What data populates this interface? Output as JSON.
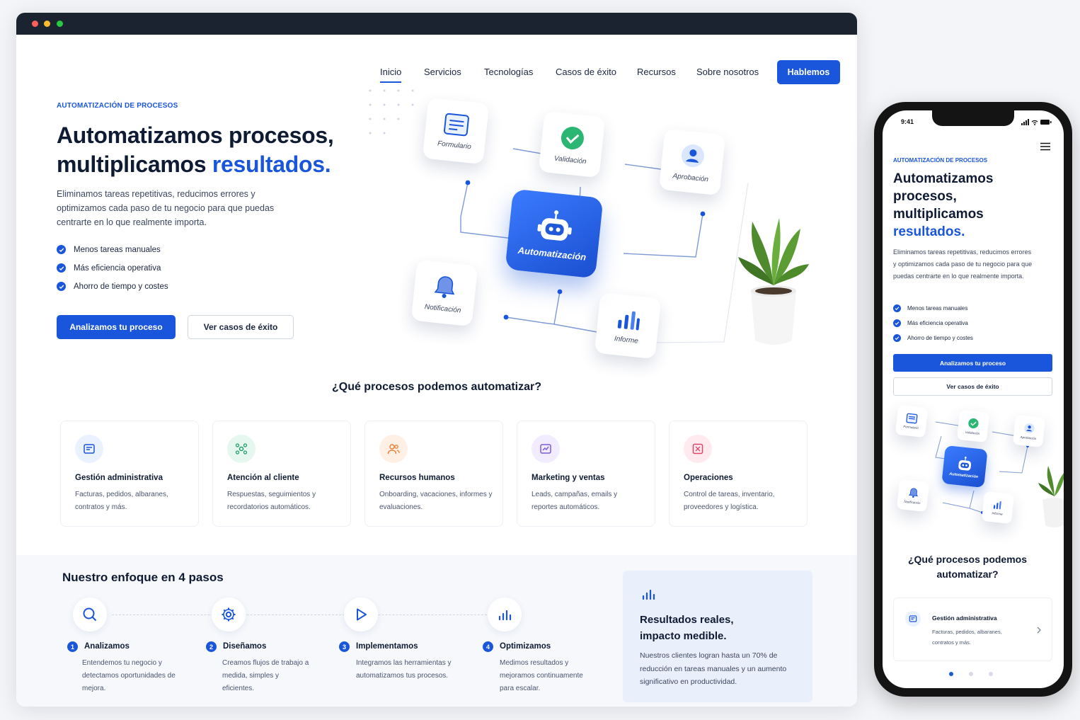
{
  "window": {
    "dots": [
      "#ff5f57",
      "#febc2e",
      "#28c840"
    ]
  },
  "nav": {
    "items": [
      "Inicio",
      "Servicios",
      "Tecnologías",
      "Casos de éxito",
      "Recursos",
      "Sobre nosotros"
    ],
    "cta": "Hablemos"
  },
  "hero": {
    "eyebrow": "AUTOMATIZACIÓN DE PROCESOS",
    "title_line1": "Automatizamos procesos,",
    "title_line2": "multiplicamos ",
    "title_highlight": "resultados.",
    "description": "Eliminamos tareas repetitivas, reducimos errores y optimizamos cada paso de tu negocio para que puedas centrarte en lo que realmente importa.",
    "benefits": [
      "Menos tareas manuales",
      "Más eficiencia operativa",
      "Ahorro de tiempo y costes"
    ],
    "primary_cta": "Analizamos tu proceso",
    "secondary_cta": "Ver casos de éxito"
  },
  "diagram": {
    "center": "Automatización",
    "nodes": [
      "Formulario",
      "Validación",
      "Aprobación",
      "Notificación",
      "Informe"
    ]
  },
  "processes": {
    "title": "¿Qué procesos podemos automatizar?",
    "items": [
      {
        "title": "Gestión administrativa",
        "desc": "Facturas, pedidos, albaranes, contratos y más.",
        "icon": "document-icon",
        "color": "#eaf1ff",
        "fg": "#1a56db"
      },
      {
        "title": "Atención al cliente",
        "desc": "Respuestas, seguimientos y recordatorios automáticos.",
        "icon": "network-icon",
        "color": "#e6f7ef",
        "fg": "#22a06b"
      },
      {
        "title": "Recursos humanos",
        "desc": "Onboarding, vacaciones, informes y evaluaciones.",
        "icon": "users-icon",
        "color": "#fff0e6",
        "fg": "#e8833a"
      },
      {
        "title": "Marketing y ventas",
        "desc": "Leads, campañas, emails y reportes automáticos.",
        "icon": "chart-board-icon",
        "color": "#f1ecff",
        "fg": "#7c5ce0"
      },
      {
        "title": "Operaciones",
        "desc": "Control de tareas, inventario, proveedores y logística.",
        "icon": "box-icon",
        "color": "#ffeaf0",
        "fg": "#e0456c"
      }
    ]
  },
  "approach": {
    "title": "Nuestro enfoque en 4 pasos",
    "steps": [
      {
        "n": "1",
        "title": "Analizamos",
        "desc": "Entendemos tu negocio y detectamos oportunidades de mejora.",
        "icon": "search-icon"
      },
      {
        "n": "2",
        "title": "Diseñamos",
        "desc": "Creamos flujos de trabajo a medida, simples y eficientes.",
        "icon": "gear-icon"
      },
      {
        "n": "3",
        "title": "Implementamos",
        "desc": "Integramos las herramientas y automatizamos tus procesos.",
        "icon": "play-icon"
      },
      {
        "n": "4",
        "title": "Optimizamos",
        "desc": "Medimos resultados y mejoramos continuamente para escalar.",
        "icon": "bar-chart-icon"
      }
    ],
    "results_title_1": "Resultados reales,",
    "results_title_2": "impacto medible.",
    "results_desc": "Nuestros clientes logran hasta un 70% de reducción en tareas manuales y un aumento significativo en productividad."
  },
  "mobile": {
    "time": "9:41",
    "eyebrow": "AUTOMATIZACIÓN DE PROCESOS",
    "title_1": "Automatizamos",
    "title_2": "procesos,",
    "title_3": "multiplicamos",
    "title_4": "resultados.",
    "description": "Eliminamos tareas repetitivas, reducimos errores y optimizamos cada paso de tu negocio para que puedas centrarte en lo que realmente importa.",
    "benefits": [
      "Menos tareas manuales",
      "Más eficiencia operativa",
      "Ahorro de tiempo y costes"
    ],
    "primary_cta": "Analizamos tu proceso",
    "secondary_cta": "Ver casos de éxito",
    "diagram_center": "Automatización",
    "diagram_nodes": [
      "Formulario",
      "Validación",
      "Aprobación",
      "Notificación",
      "Informe"
    ],
    "section_title_1": "¿Qué procesos podemos",
    "section_title_2": "automatizar?",
    "card_title": "Gestión administrativa",
    "card_desc": "Facturas, pedidos, albaranes, contratos y más.",
    "pagination_active": 0
  }
}
